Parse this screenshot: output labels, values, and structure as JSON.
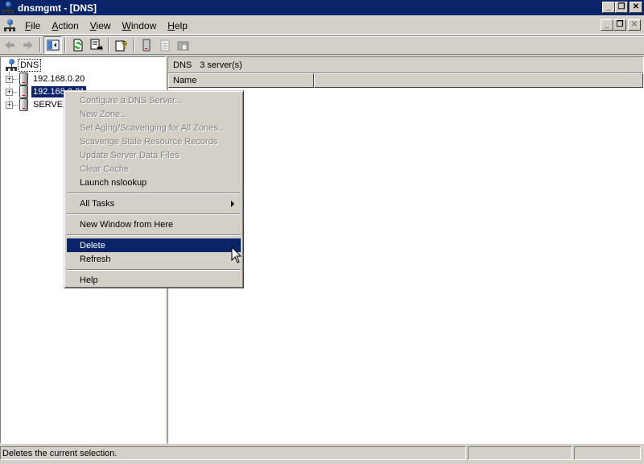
{
  "window": {
    "title": "dnsmgmt - [DNS]",
    "controls": {
      "minimize": "_",
      "restore": "❐",
      "close": "✕"
    }
  },
  "menubar": {
    "items": [
      {
        "label": "File",
        "accel": "F",
        "rest": "ile"
      },
      {
        "label": "Action",
        "accel": "A",
        "rest": "ction"
      },
      {
        "label": "View",
        "accel": "V",
        "rest": "iew"
      },
      {
        "label": "Window",
        "accel": "W",
        "rest": "indow"
      },
      {
        "label": "Help",
        "accel": "H",
        "rest": "elp"
      }
    ]
  },
  "toolbar": {
    "buttons": [
      {
        "name": "back",
        "icon": "back-arrow-icon",
        "enabled": false
      },
      {
        "name": "forward",
        "icon": "forward-arrow-icon",
        "enabled": false
      },
      {
        "name": "show-hide-console-tree",
        "icon": "console-tree-icon",
        "pressed": true
      },
      {
        "name": "refresh",
        "icon": "refresh-icon"
      },
      {
        "name": "export-list",
        "icon": "export-list-icon"
      },
      {
        "name": "help",
        "icon": "help-icon"
      },
      {
        "name": "server",
        "icon": "server-icon"
      },
      {
        "name": "properties",
        "icon": "notepad-icon",
        "enabled": false
      },
      {
        "name": "new-window",
        "icon": "folder-icon",
        "enabled": false
      }
    ]
  },
  "tree": {
    "root": {
      "label": "DNS",
      "icon": "dns-icon"
    },
    "servers": [
      {
        "label": "192.168.0.20",
        "selected": false
      },
      {
        "label": "192.168.0.21",
        "selected": true
      },
      {
        "label": "SERVER",
        "selected": false
      }
    ]
  },
  "details": {
    "header": {
      "node": "DNS",
      "count": "3 server(s)"
    },
    "columns": [
      "Name",
      ""
    ]
  },
  "context_menu": {
    "groups": [
      [
        {
          "label": "Configure a DNS Server...",
          "enabled": false
        },
        {
          "label": "New Zone...",
          "enabled": false
        },
        {
          "label": "Set Aging/Scavenging for All Zones...",
          "enabled": false
        },
        {
          "label": "Scavenge Stale Resource Records",
          "enabled": false
        },
        {
          "label": "Update Server Data Files",
          "enabled": false
        },
        {
          "label": "Clear Cache",
          "enabled": false
        },
        {
          "label": "Launch nslookup",
          "enabled": true
        }
      ],
      [
        {
          "label": "All Tasks",
          "enabled": true,
          "submenu": true
        }
      ],
      [
        {
          "label": "New Window from Here",
          "enabled": true
        }
      ],
      [
        {
          "label": "Delete",
          "enabled": true,
          "highlighted": true
        },
        {
          "label": "Refresh",
          "enabled": true
        }
      ],
      [
        {
          "label": "Help",
          "enabled": true
        }
      ]
    ]
  },
  "statusbar": {
    "text": "Deletes the current selection.",
    "panels": [
      "",
      "",
      ""
    ]
  },
  "colors": {
    "titlebar": "#0a246a",
    "face": "#d4d0c8",
    "highlight": "#0a246a",
    "disabled_text": "#808080"
  }
}
